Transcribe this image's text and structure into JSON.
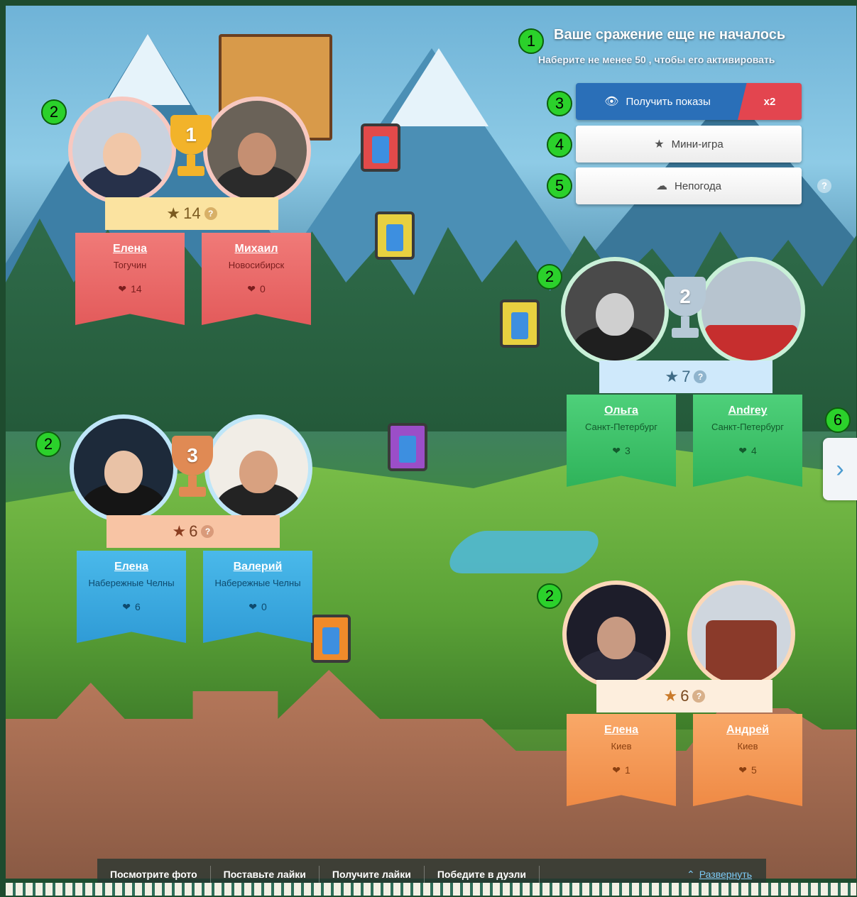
{
  "header": {
    "title": "Ваше сражение еще не началось",
    "subtitle": "Наберите не менее 50 , чтобы его активировать"
  },
  "actions": {
    "get_views_label": "Получить показы",
    "multiplier": "x2",
    "mini_game_label": "Мини-игра",
    "weather_label": "Непогода",
    "help": "?"
  },
  "markers": [
    "1",
    "2",
    "3",
    "4",
    "5",
    "6"
  ],
  "duels": [
    {
      "place": "1",
      "stars": "14",
      "color": "#e35b5b",
      "players": [
        {
          "name": "Елена",
          "city": "Тогучин",
          "likes": "14"
        },
        {
          "name": "Михаил",
          "city": "Новосибирск",
          "likes": "0"
        }
      ]
    },
    {
      "place": "2",
      "stars": "7",
      "color": "#2fb35a",
      "players": [
        {
          "name": "Ольга",
          "city": "Санкт-Петербург",
          "likes": "3"
        },
        {
          "name": "Andrey",
          "city": "Санкт-Петербург",
          "likes": "4"
        }
      ]
    },
    {
      "place": "3",
      "stars": "6",
      "color": "#2f9bd6",
      "players": [
        {
          "name": "Елена",
          "city": "Набережные Челны",
          "likes": "6"
        },
        {
          "name": "Валерий",
          "city": "Набережные Челны",
          "likes": "0"
        }
      ]
    },
    {
      "place": "",
      "stars": "6",
      "color": "#ef8a45",
      "players": [
        {
          "name": "Елена",
          "city": "Киев",
          "likes": "1"
        },
        {
          "name": "Андрей",
          "city": "Киев",
          "likes": "5"
        }
      ]
    }
  ],
  "bottom_bar": {
    "tabs": [
      "Посмотрите фото",
      "Поставьте лайки",
      "Получите лайки",
      "Победите в дуэли"
    ],
    "expand_label": "Развернуть"
  },
  "icons": {
    "eye": "eye-icon",
    "star": "star-icon",
    "cloud": "cloud-icon",
    "heart": "heart-icon",
    "chevron_right": "chevron-right-icon",
    "chevron_up": "chevron-up-icon"
  }
}
